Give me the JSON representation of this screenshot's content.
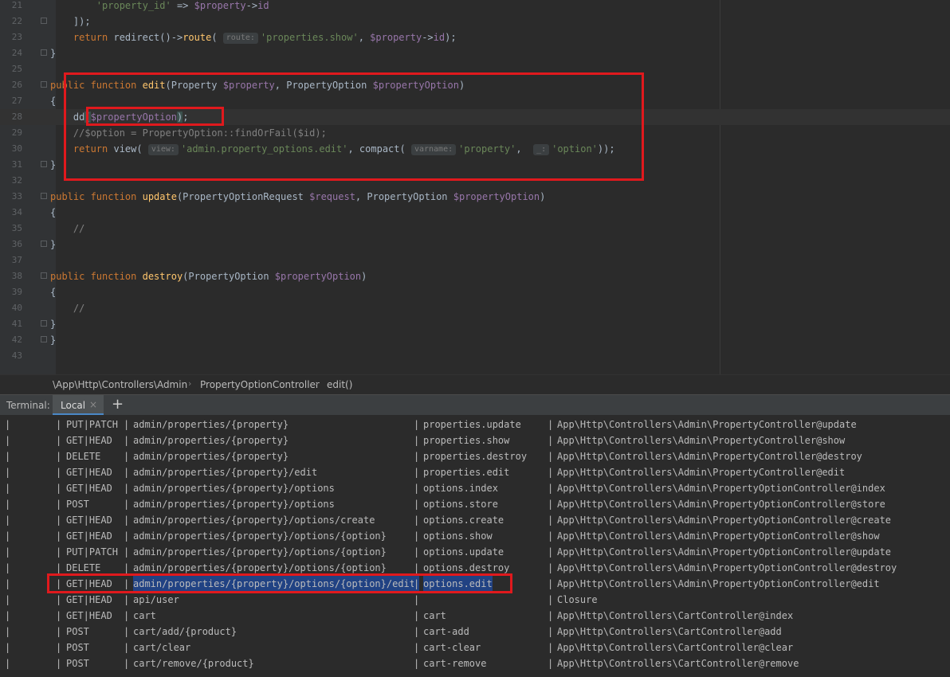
{
  "editor": {
    "lines": [
      {
        "num": "21",
        "tokens": [
          {
            "t": "        "
          },
          {
            "t": "'property_id'",
            "c": "str"
          },
          {
            "t": " => "
          },
          {
            "t": "$property",
            "c": "var"
          },
          {
            "t": "->"
          },
          {
            "t": "id",
            "c": "var"
          }
        ]
      },
      {
        "num": "22",
        "fold": true,
        "tokens": [
          {
            "t": "    ]);"
          }
        ]
      },
      {
        "num": "23",
        "tokens": [
          {
            "t": "    "
          },
          {
            "t": "return ",
            "c": "kw"
          },
          {
            "t": "redirect()->"
          },
          {
            "t": "route",
            "c": "fn"
          },
          {
            "t": "( "
          },
          {
            "t": "route:",
            "c": "hint"
          },
          {
            "t": "'properties.show'",
            "c": "str"
          },
          {
            "t": ", "
          },
          {
            "t": "$property",
            "c": "var"
          },
          {
            "t": "->"
          },
          {
            "t": "id",
            "c": "var"
          },
          {
            "t": ");"
          }
        ]
      },
      {
        "num": "24",
        "fold": true,
        "tokens": [
          {
            "t": "}"
          }
        ]
      },
      {
        "num": "25",
        "tokens": []
      },
      {
        "num": "26",
        "fold": true,
        "tokens": [
          {
            "t": "public function ",
            "c": "kw"
          },
          {
            "t": "edit",
            "c": "fn"
          },
          {
            "t": "(Property "
          },
          {
            "t": "$property",
            "c": "var"
          },
          {
            "t": ", PropertyOption "
          },
          {
            "t": "$propertyOption",
            "c": "var"
          },
          {
            "t": ")"
          }
        ]
      },
      {
        "num": "27",
        "tokens": [
          {
            "t": "{"
          }
        ]
      },
      {
        "num": "28",
        "current": true,
        "tokens": [
          {
            "t": "    dd"
          },
          {
            "t": "(",
            "c": "bracket-hl"
          },
          {
            "t": "$propertyOption",
            "c": "var"
          },
          {
            "t": ")",
            "c": "bracket-hl"
          },
          {
            "t": ";"
          }
        ]
      },
      {
        "num": "29",
        "tokens": [
          {
            "t": "    "
          },
          {
            "t": "//$option = PropertyOption::findOrFail($id);",
            "c": "cmt"
          }
        ]
      },
      {
        "num": "30",
        "tokens": [
          {
            "t": "    "
          },
          {
            "t": "return ",
            "c": "kw"
          },
          {
            "t": "view( "
          },
          {
            "t": "view:",
            "c": "hint"
          },
          {
            "t": "'admin.property_options.edit'",
            "c": "str"
          },
          {
            "t": ", compact( "
          },
          {
            "t": "varname:",
            "c": "hint"
          },
          {
            "t": "'property'",
            "c": "str"
          },
          {
            "t": ",  "
          },
          {
            "t": "_:",
            "c": "hint"
          },
          {
            "t": "'option'",
            "c": "str"
          },
          {
            "t": "));"
          }
        ]
      },
      {
        "num": "31",
        "fold": true,
        "tokens": [
          {
            "t": "}"
          }
        ]
      },
      {
        "num": "32",
        "tokens": []
      },
      {
        "num": "33",
        "fold": true,
        "tokens": [
          {
            "t": "public function ",
            "c": "kw"
          },
          {
            "t": "update",
            "c": "fn"
          },
          {
            "t": "(PropertyOptionRequest "
          },
          {
            "t": "$request",
            "c": "var"
          },
          {
            "t": ", PropertyOption "
          },
          {
            "t": "$propertyOption",
            "c": "var"
          },
          {
            "t": ")"
          }
        ]
      },
      {
        "num": "34",
        "tokens": [
          {
            "t": "{"
          }
        ]
      },
      {
        "num": "35",
        "tokens": [
          {
            "t": "    "
          },
          {
            "t": "//",
            "c": "cmt"
          }
        ]
      },
      {
        "num": "36",
        "fold": true,
        "tokens": [
          {
            "t": "}"
          }
        ]
      },
      {
        "num": "37",
        "tokens": []
      },
      {
        "num": "38",
        "fold": true,
        "tokens": [
          {
            "t": "public function ",
            "c": "kw"
          },
          {
            "t": "destroy",
            "c": "fn"
          },
          {
            "t": "(PropertyOption "
          },
          {
            "t": "$propertyOption",
            "c": "var"
          },
          {
            "t": ")"
          }
        ]
      },
      {
        "num": "39",
        "tokens": [
          {
            "t": "{"
          }
        ]
      },
      {
        "num": "40",
        "tokens": [
          {
            "t": "    "
          },
          {
            "t": "//",
            "c": "cmt"
          }
        ]
      },
      {
        "num": "41",
        "fold": true,
        "tokens": [
          {
            "t": "}"
          }
        ]
      },
      {
        "num": "42",
        "fold": true,
        "tokens": [
          {
            "t": "}"
          }
        ]
      },
      {
        "num": "43",
        "tokens": []
      }
    ]
  },
  "breadcrumb": {
    "namespace": "\\App\\Http\\Controllers\\Admin",
    "class": "PropertyOptionController",
    "method": "edit()"
  },
  "terminal": {
    "title": "Terminal:",
    "tab_label": "Local",
    "tab_close": "×",
    "add_label": "+",
    "rows": [
      {
        "method": "PUT|PATCH",
        "uri": "admin/properties/{property}",
        "name": "properties.update",
        "action": "App\\Http\\Controllers\\Admin\\PropertyController@update"
      },
      {
        "method": "GET|HEAD",
        "uri": "admin/properties/{property}",
        "name": "properties.show",
        "action": "App\\Http\\Controllers\\Admin\\PropertyController@show"
      },
      {
        "method": "DELETE",
        "uri": "admin/properties/{property}",
        "name": "properties.destroy",
        "action": "App\\Http\\Controllers\\Admin\\PropertyController@destroy"
      },
      {
        "method": "GET|HEAD",
        "uri": "admin/properties/{property}/edit",
        "name": "properties.edit",
        "action": "App\\Http\\Controllers\\Admin\\PropertyController@edit"
      },
      {
        "method": "GET|HEAD",
        "uri": "admin/properties/{property}/options",
        "name": "options.index",
        "action": "App\\Http\\Controllers\\Admin\\PropertyOptionController@index"
      },
      {
        "method": "POST",
        "uri": "admin/properties/{property}/options",
        "name": "options.store",
        "action": "App\\Http\\Controllers\\Admin\\PropertyOptionController@store"
      },
      {
        "method": "GET|HEAD",
        "uri": "admin/properties/{property}/options/create",
        "name": "options.create",
        "action": "App\\Http\\Controllers\\Admin\\PropertyOptionController@create"
      },
      {
        "method": "GET|HEAD",
        "uri": "admin/properties/{property}/options/{option}",
        "name": "options.show",
        "action": "App\\Http\\Controllers\\Admin\\PropertyOptionController@show"
      },
      {
        "method": "PUT|PATCH",
        "uri": "admin/properties/{property}/options/{option}",
        "name": "options.update",
        "action": "App\\Http\\Controllers\\Admin\\PropertyOptionController@update"
      },
      {
        "method": "DELETE",
        "uri": "admin/properties/{property}/options/{option}",
        "name": "options.destroy",
        "action": "App\\Http\\Controllers\\Admin\\PropertyOptionController@destroy"
      },
      {
        "method": "GET|HEAD",
        "uri": "admin/properties/{property}/options/{option}/edit",
        "name": "options.edit",
        "action": "App\\Http\\Controllers\\Admin\\PropertyOptionController@edit",
        "selected": true
      },
      {
        "method": "GET|HEAD",
        "uri": "api/user",
        "name": "",
        "action": "Closure"
      },
      {
        "method": "GET|HEAD",
        "uri": "cart",
        "name": "cart",
        "action": "App\\Http\\Controllers\\CartController@index"
      },
      {
        "method": "POST",
        "uri": "cart/add/{product}",
        "name": "cart-add",
        "action": "App\\Http\\Controllers\\CartController@add"
      },
      {
        "method": "POST",
        "uri": "cart/clear",
        "name": "cart-clear",
        "action": "App\\Http\\Controllers\\CartController@clear"
      },
      {
        "method": "POST",
        "uri": "cart/remove/{product}",
        "name": "cart-remove",
        "action": "App\\Http\\Controllers\\CartController@remove"
      }
    ]
  },
  "colors": {
    "editor_bg": "#2b2b2b",
    "keyword": "#cc7832",
    "function": "#ffc66d",
    "variable": "#9876aa",
    "string": "#6a8759",
    "comment": "#808080",
    "selection": "#214283",
    "annotation_box": "#e0191d"
  }
}
